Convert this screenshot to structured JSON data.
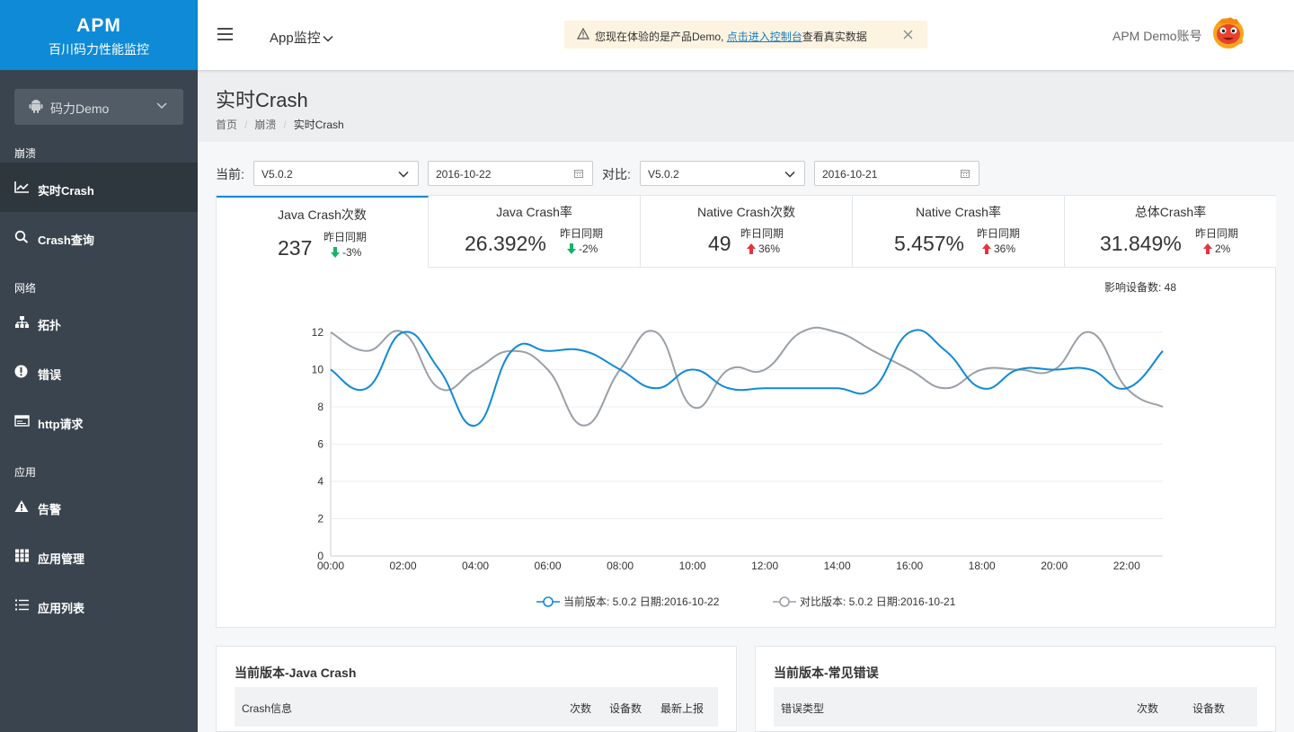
{
  "brand": {
    "name": "APM",
    "subtitle": "百川码力性能监控"
  },
  "sidebar": {
    "app_select": "码力Demo",
    "sections": [
      {
        "label": "崩溃"
      },
      {
        "label": "网络"
      },
      {
        "label": "应用"
      }
    ],
    "items": [
      {
        "label": "实时Crash",
        "icon": "line-chart-icon",
        "active": true
      },
      {
        "label": "Crash查询",
        "icon": "search-icon"
      },
      {
        "label": "拓扑",
        "icon": "sitemap-icon"
      },
      {
        "label": "错误",
        "icon": "exclamation-circle-icon"
      },
      {
        "label": "http请求",
        "icon": "browser-window-icon"
      },
      {
        "label": "告警",
        "icon": "warning-icon"
      },
      {
        "label": "应用管理",
        "icon": "grid-icon"
      },
      {
        "label": "应用列表",
        "icon": "list-icon"
      }
    ]
  },
  "header": {
    "app_monitor": "App监控",
    "notice_prefix": "您现在体验的是产品Demo, ",
    "notice_link": "点击进入控制台",
    "notice_suffix": "查看真实数据",
    "account": "APM Demo账号"
  },
  "page": {
    "title": "实时Crash",
    "breadcrumb": [
      "首页",
      "崩溃",
      "实时Crash"
    ]
  },
  "filters": {
    "current_label": "当前:",
    "current_version": "V5.0.2",
    "current_date": "2016-10-22",
    "compare_label": "对比:",
    "compare_version": "V5.0.2",
    "compare_date": "2016-10-21"
  },
  "metrics": [
    {
      "title": "Java Crash次数",
      "value": "237",
      "cmp_label": "昨日同期",
      "cmp_value": "-3%",
      "trend": "down"
    },
    {
      "title": "Java Crash率",
      "value": "26.392%",
      "cmp_label": "昨日同期",
      "cmp_value": "-2%",
      "trend": "down"
    },
    {
      "title": "Native Crash次数",
      "value": "49",
      "cmp_label": "昨日同期",
      "cmp_value": "36%",
      "trend": "up"
    },
    {
      "title": "Native Crash率",
      "value": "5.457%",
      "cmp_label": "昨日同期",
      "cmp_value": "36%",
      "trend": "up"
    },
    {
      "title": "总体Crash率",
      "value": "31.849%",
      "cmp_label": "昨日同期",
      "cmp_value": "2%",
      "trend": "up"
    }
  ],
  "affected_devices": "影响设备数: 48",
  "colors": {
    "primary": "#0f8ad6",
    "compare": "#9aa0a6",
    "sidebar": "#3a444e",
    "up": "#e8323c",
    "down": "#17b26a"
  },
  "chart_data": {
    "type": "line",
    "x": [
      "00:00",
      "01:00",
      "02:00",
      "03:00",
      "04:00",
      "05:00",
      "06:00",
      "07:00",
      "08:00",
      "09:00",
      "10:00",
      "11:00",
      "12:00",
      "13:00",
      "14:00",
      "15:00",
      "16:00",
      "17:00",
      "18:00",
      "19:00",
      "20:00",
      "21:00",
      "22:00",
      "23:00"
    ],
    "x_tick_labels": [
      "00:00",
      "02:00",
      "04:00",
      "06:00",
      "08:00",
      "10:00",
      "12:00",
      "14:00",
      "16:00",
      "18:00",
      "20:00",
      "22:00"
    ],
    "ylim": [
      0,
      12
    ],
    "y_ticks": [
      0,
      2,
      4,
      6,
      8,
      10,
      12
    ],
    "series": [
      {
        "name": "当前版本: 5.0.2 日期:2016-10-22",
        "color": "#0f8ad6",
        "values": [
          10,
          9,
          12,
          10,
          7,
          11,
          11,
          11,
          10,
          9,
          10,
          9,
          9,
          9,
          9,
          9,
          12,
          11,
          9,
          10,
          10,
          10,
          9,
          11
        ]
      },
      {
        "name": "对比版本: 5.0.2 日期:2016-10-21",
        "color": "#9aa0a6",
        "values": [
          12,
          11,
          12,
          9,
          10,
          11,
          10,
          7,
          10,
          12,
          8,
          10,
          10,
          12,
          12,
          11,
          10,
          9,
          10,
          10,
          10,
          12,
          9,
          8
        ]
      }
    ],
    "grid": true,
    "legend_position": "bottom"
  },
  "tables": [
    {
      "title": "当前版本-Java Crash",
      "columns": [
        "Crash信息",
        "次数",
        "设备数",
        "最新上报"
      ]
    },
    {
      "title": "当前版本-常见错误",
      "columns": [
        "错误类型",
        "次数",
        "设备数"
      ]
    }
  ]
}
